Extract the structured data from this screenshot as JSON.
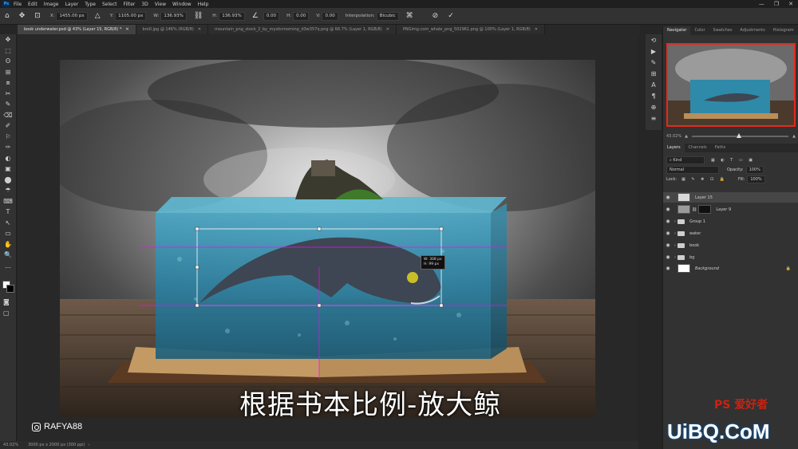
{
  "menu": {
    "app_icon": "Ps",
    "items": [
      "File",
      "Edit",
      "Image",
      "Layer",
      "Type",
      "Select",
      "Filter",
      "3D",
      "View",
      "Window",
      "Help"
    ],
    "window_controls": [
      "—",
      "❐",
      "✕"
    ]
  },
  "options_bar": {
    "x_label": "X:",
    "x_value": "1455.00 px",
    "y_label": "Y:",
    "y_value": "1105.00 px",
    "w_label": "W:",
    "w_value": "136.93%",
    "h_label": "H:",
    "h_value": "136.93%",
    "angle_value": "0.00",
    "hskew_label": "H:",
    "hskew_value": "0.00",
    "vskew_label": "V:",
    "vskew_value": "0.00",
    "interp_label": "Interpolation:",
    "interp_value": "Bicubic"
  },
  "tabs": [
    {
      "label": "book underwater.psd @ 43% (Layer 15, RGB/8) *",
      "active": true
    },
    {
      "label": "bro0.jpg @ 146% (RGB/8)",
      "active": false
    },
    {
      "label": "mountain_png_stock_2_by_mysticmorning_d3w357q.png @ 66.7% (Layer 1, RGB/8)",
      "active": false
    },
    {
      "label": "PNGimg.com_whale_png_502961.png @ 100% (Layer 1, RGB/8)",
      "active": false
    }
  ],
  "tools": [
    "✥",
    "⬚",
    "ʘ",
    "⊞",
    "⧈",
    "✂",
    "✎",
    "⌫",
    "✐",
    "⚐",
    "✑",
    "◐",
    "▣",
    "⬤",
    "☂",
    "⌨",
    "T",
    "↖",
    "▭",
    "✋",
    "🔍",
    "…"
  ],
  "canvas": {
    "subtitle": "根据书本比例-放大鲸",
    "instagram": "RAFYA88",
    "tooltip_w": "W: 308 px",
    "tooltip_h": "H: 99 px"
  },
  "status": {
    "zoom": "43.02%",
    "doc": "3000 px x 2000 px (300 ppi)"
  },
  "navigator": {
    "tabs": [
      "Navigator",
      "Color",
      "Swatches",
      "Adjustments",
      "Histogram"
    ],
    "zoom": "43.02%"
  },
  "layers_panel": {
    "tabs": [
      "Layers",
      "Channels",
      "Paths"
    ],
    "kind_label": "Kind",
    "blend_mode": "Normal",
    "opacity_label": "Opacity:",
    "opacity_value": "100%",
    "lock_label": "Lock:",
    "fill_label": "Fill:",
    "fill_value": "100%",
    "layers": [
      {
        "name": "Layer 15",
        "type": "pixel",
        "selected": true
      },
      {
        "name": "Layer 9",
        "type": "pixel",
        "selected": false
      },
      {
        "name": "Group 1",
        "type": "group",
        "selected": false
      },
      {
        "name": "water",
        "type": "group",
        "selected": false
      },
      {
        "name": "book",
        "type": "group",
        "selected": false
      },
      {
        "name": "bg",
        "type": "group",
        "selected": false
      },
      {
        "name": "Background",
        "type": "background",
        "selected": false
      }
    ]
  },
  "watermark": {
    "main": "UiBQ.CoM",
    "top": "PS 爱好者"
  },
  "colors": {
    "accent_red": "#e42a1c",
    "panel_bg": "#323232",
    "canvas_bg": "#282828"
  }
}
